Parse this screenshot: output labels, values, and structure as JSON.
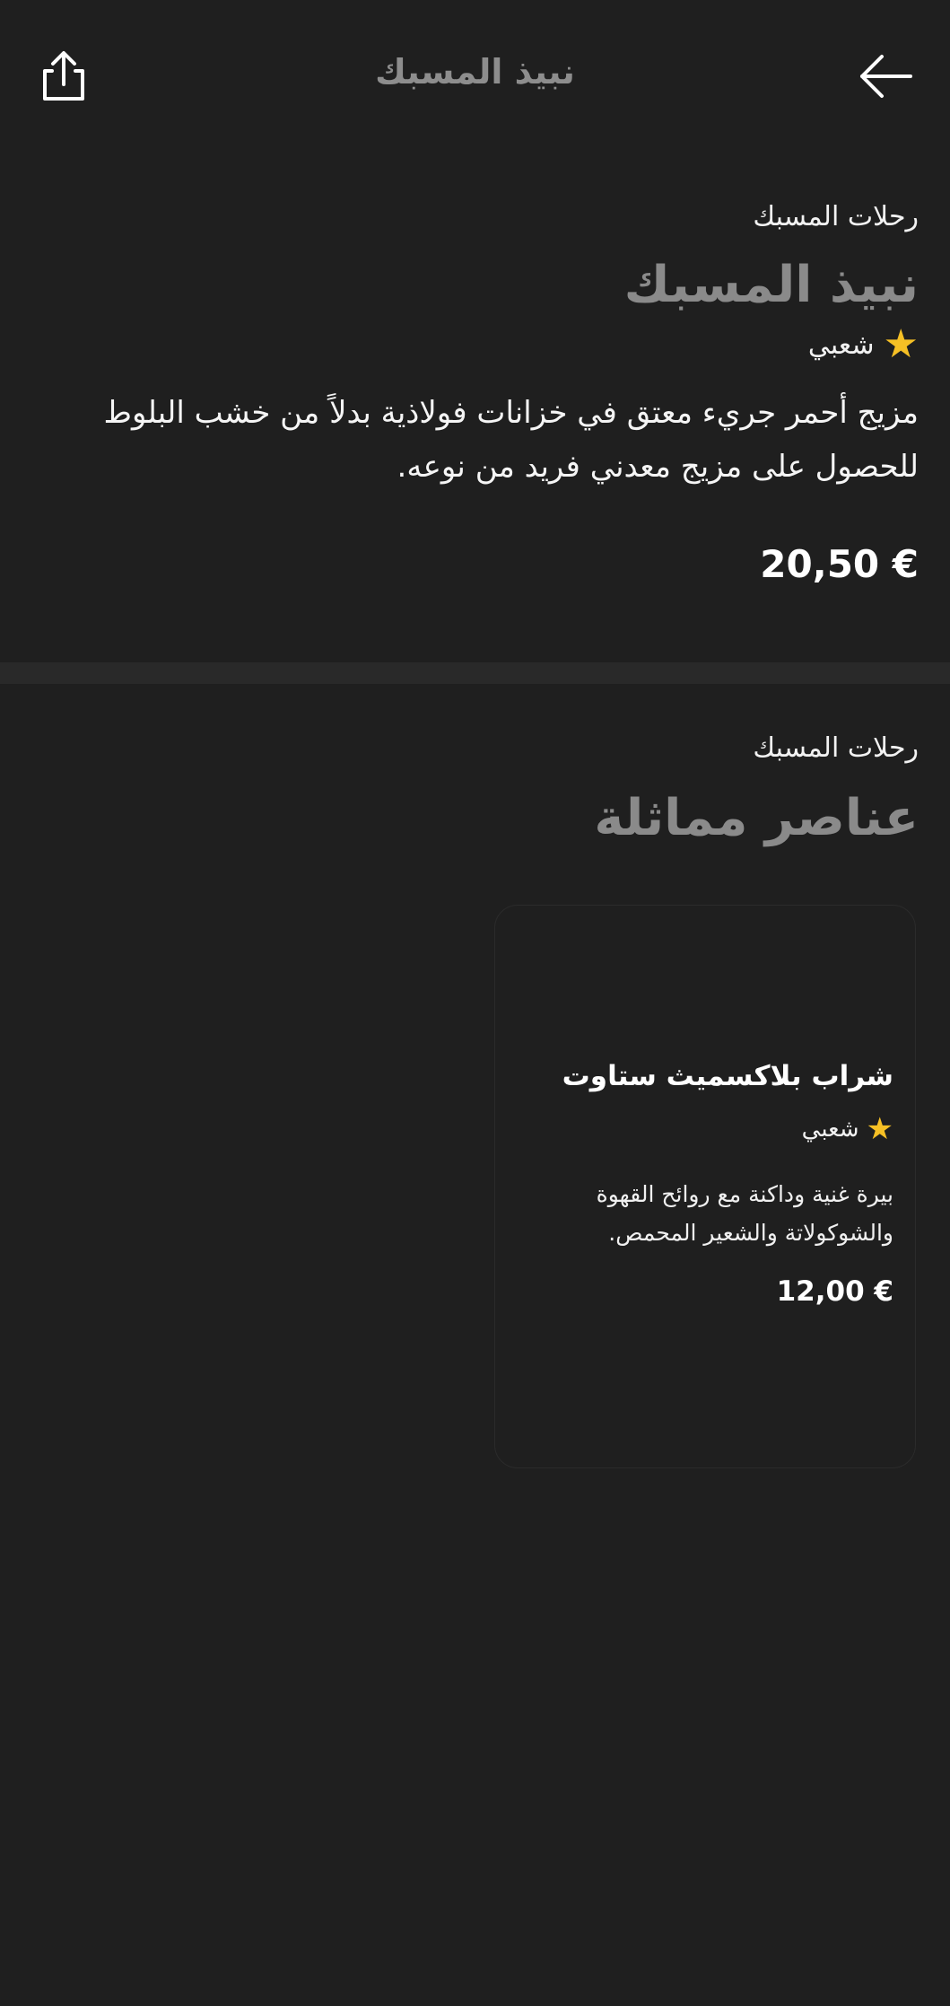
{
  "header": {
    "title": "نبيذ المسبك",
    "share_icon": "share-icon",
    "back_icon": "arrow-back-icon"
  },
  "product": {
    "category": "رحلات المسبك",
    "name": "نبيذ المسبك",
    "rating_icon": "star-icon",
    "rating_label": "شعبي",
    "description": "مزيج أحمر جريء معتق في خزانات فولاذية بدلاً من خشب البلوط للحصول على مزيج معدني فريد من نوعه.",
    "price": "20,50 €"
  },
  "similar": {
    "category": "رحلات المسبك",
    "title": "عناصر مماثلة",
    "items": [
      {
        "name": "شراب بلاكسميث ستاوت",
        "rating_label": "شعبي",
        "description": "بيرة غنية وداكنة مع روائح القهوة والشوكولاتة والشعير المحمص.",
        "price": "12,00 €"
      }
    ]
  },
  "colors": {
    "background": "#1f1f1f",
    "star": "#f6c025",
    "muted_title": "#8a8a8a"
  }
}
